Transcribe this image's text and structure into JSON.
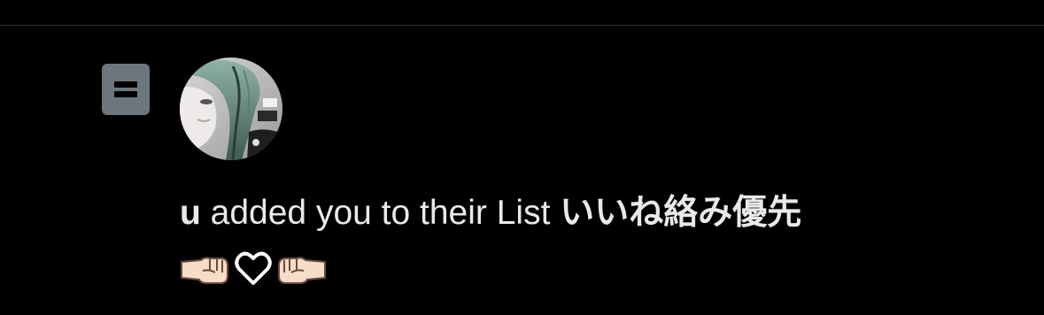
{
  "notification": {
    "username": "u",
    "action_text": "added you to their List",
    "list_name": "いいね絡み優先",
    "list_name_emoji": [
      "left-facing-fist-icon",
      "white-heart-icon",
      "right-facing-fist-icon"
    ]
  },
  "icons": {
    "list_icon": "list-icon",
    "avatar": "user-avatar"
  },
  "colors": {
    "background": "#000000",
    "text": "#e7e9ea",
    "icon_gray": "#6e767d",
    "divider": "#2f3336"
  }
}
